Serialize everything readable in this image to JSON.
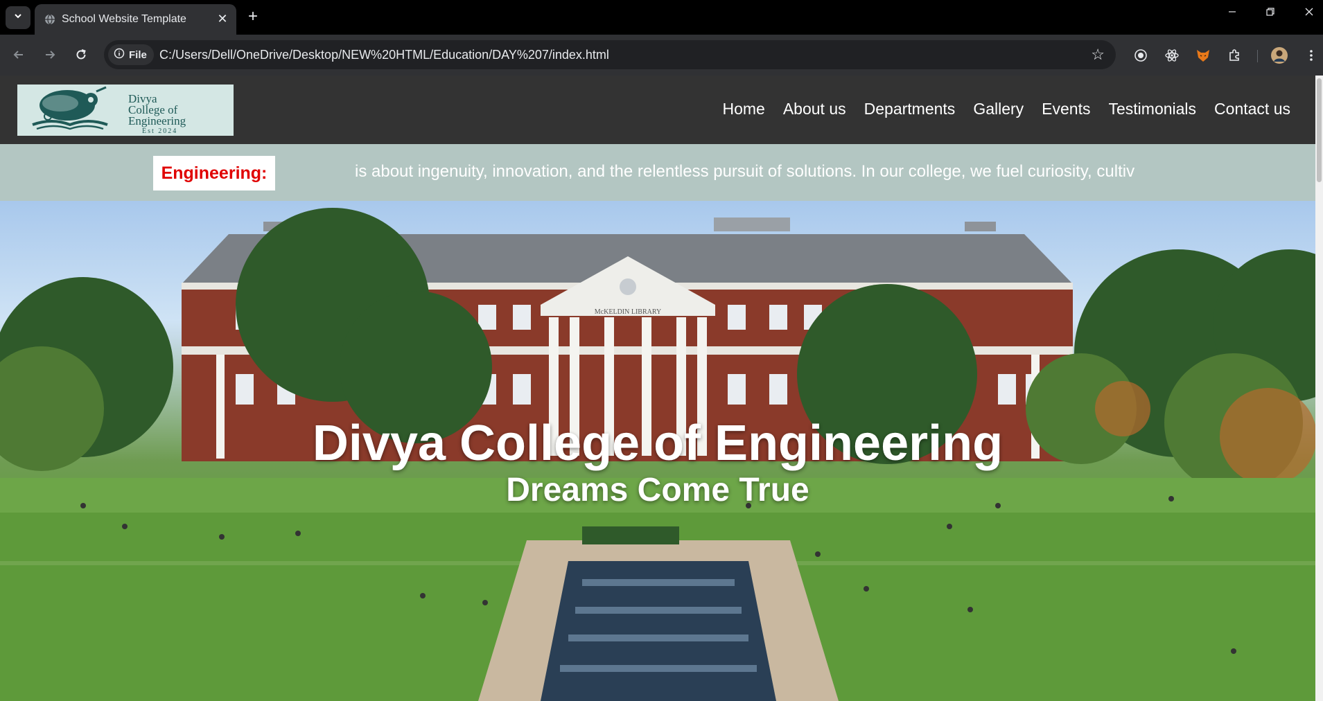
{
  "browser": {
    "tab_title": "School Website Template",
    "new_tab": "+",
    "chip_label": "File",
    "url": "C:/Users/Dell/OneDrive/Desktop/NEW%20HTML/Education/DAY%207/index.html"
  },
  "site": {
    "logo_text": [
      "Divya",
      "College of",
      "Engineering",
      "Est 2024"
    ],
    "nav": [
      "Home",
      "About us",
      "Departments",
      "Gallery",
      "Events",
      "Testimonials",
      "Contact us"
    ],
    "marquee": {
      "label": "Engineering:",
      "text": "is about ingenuity, innovation, and the relentless pursuit of solutions. In our college, we fuel curiosity, cultiv"
    },
    "hero": {
      "title": "Divya College of Engineering",
      "subtitle": "Dreams Come True",
      "building_sign": "McKELDIN LIBRARY"
    }
  },
  "colors": {
    "header_bg": "#333333",
    "marquee_bg": "#b3c6c2",
    "marquee_label": "#e00000",
    "logo_ink": "#1f5a57",
    "logo_bg": "#d4e7e4"
  }
}
